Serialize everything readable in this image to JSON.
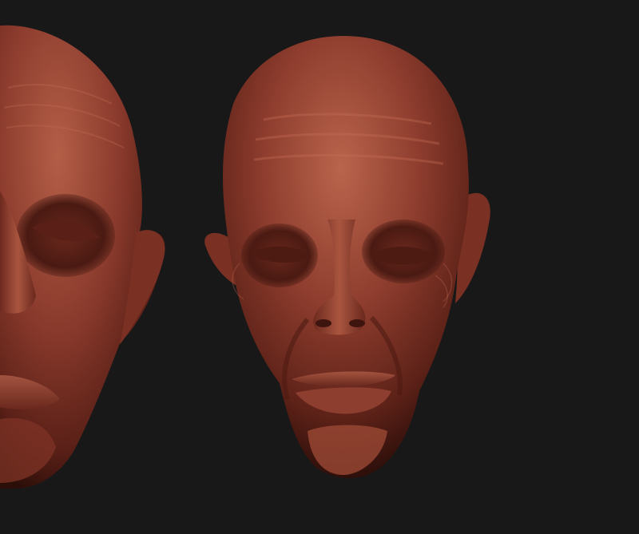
{
  "scene": {
    "background_color": "#181818",
    "clay_color": "#8a3a2c",
    "clay_highlight": "#b5604a",
    "clay_shadow": "#3e140e",
    "models": [
      {
        "name": "left-head-cropped",
        "view": "three-quarter"
      },
      {
        "name": "right-head",
        "view": "front"
      }
    ]
  }
}
